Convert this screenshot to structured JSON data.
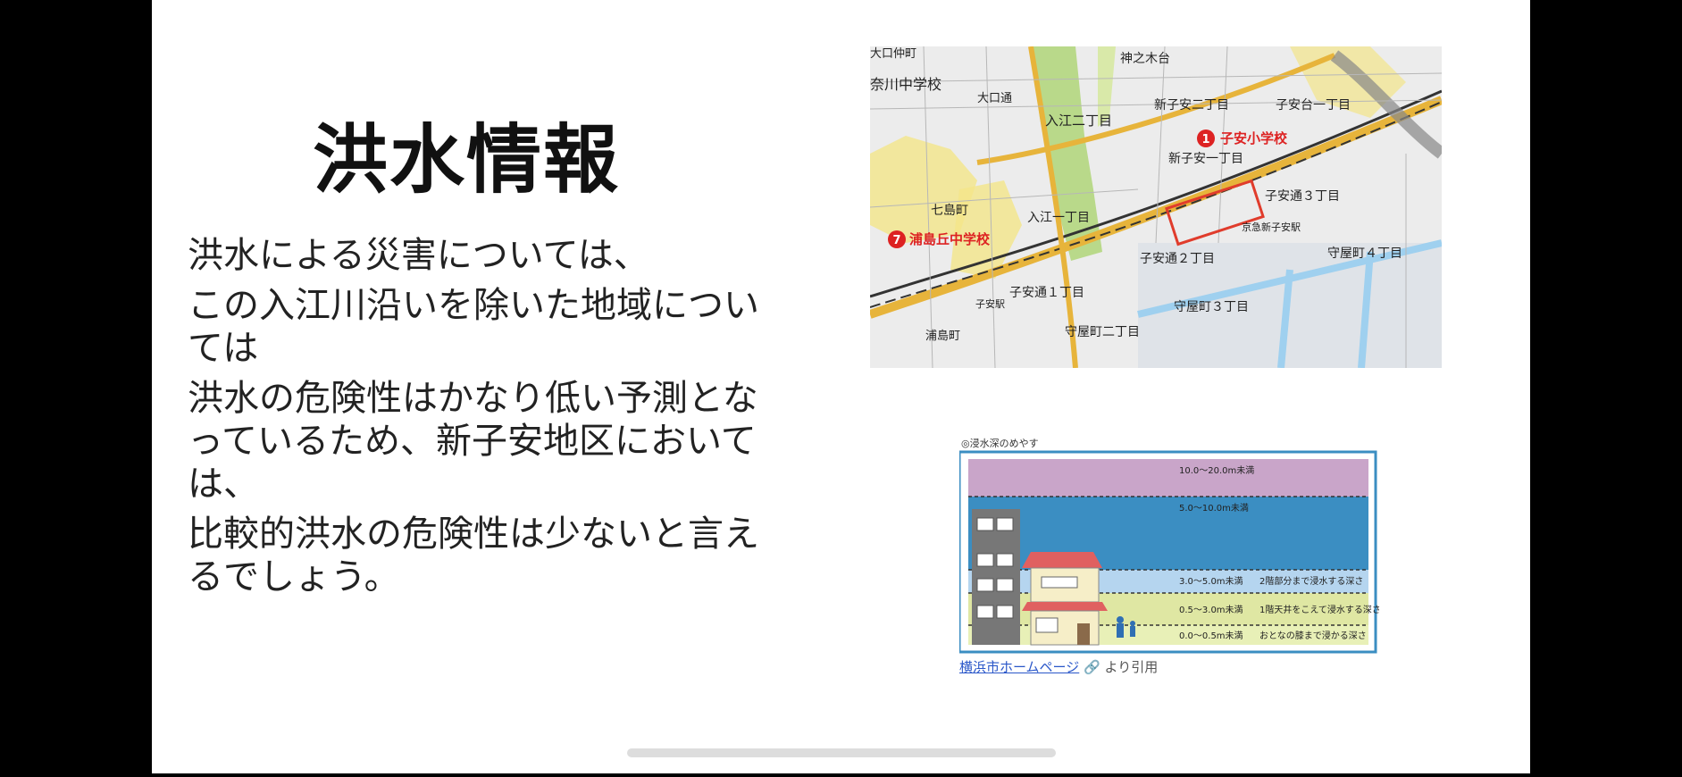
{
  "slide": {
    "title": "洪水情報",
    "paragraphs": [
      "洪水による災害については、",
      "この入江川沿いを除いた地域については",
      "洪水の危険性はかなり低い予測となっているため、新子安地区においては、",
      "比較的洪水の危険性は少ないと言えるでしょう。"
    ]
  },
  "map": {
    "labels": {
      "kanagawa_jhs": "奈川中学校",
      "oguchi_nakamachi": "大口仲町",
      "oguchi": "大口通",
      "kaminokidai": "神之木台",
      "irie_2": "入江二丁目",
      "shinkoyasu_2": "新子安二丁目",
      "koyasudai_1": "子安台一丁目",
      "koyasu_es": "子安小学校",
      "shinkoyasu_1": "新子安一丁目",
      "nanashima": "七島町",
      "irie_1": "入江一丁目",
      "urashimaoka_jhs": "浦島丘中学校",
      "koyasudori_3": "子安通３丁目",
      "koyasudori_2": "子安通２丁目",
      "koyasudori_1": "子安通１丁目",
      "moriyacho_4": "守屋町４丁目",
      "moriyacho_3": "守屋町３丁目",
      "moriyacho_2": "守屋町二丁目",
      "urashima": "浦島町",
      "koyasu_station": "子安駅",
      "keikyu_shinkoyasu": "京急新子安駅",
      "marker_1": "1",
      "marker_7": "7"
    },
    "colors": {
      "highlight": "#f4e68a",
      "green": "#b9d98a",
      "road": "#e7b43b",
      "route": "#e03c2c"
    }
  },
  "diagram": {
    "caption": "◎浸水深のめやす",
    "levels": [
      {
        "label": "10.0～20.0m未満",
        "note": "",
        "color": "#c9a5c9"
      },
      {
        "label": "5.0～10.0m未満",
        "note": "",
        "color": "#3b8ec2"
      },
      {
        "label": "3.0～5.0m未満",
        "note": "2階部分まで浸水する深さ",
        "color": "#b5d5ef"
      },
      {
        "label": "0.5～3.0m未満",
        "note": "1階天井をこえて浸水する深さ",
        "color": "#dfe7a3"
      },
      {
        "label": "0.0～0.5m未満",
        "note": "おとなの膝まで浸かる深さ",
        "color": "#e8f0b7"
      }
    ]
  },
  "citation": {
    "link_text": "横浜市ホームページ",
    "suffix": "より引用",
    "icon": "link-icon"
  }
}
